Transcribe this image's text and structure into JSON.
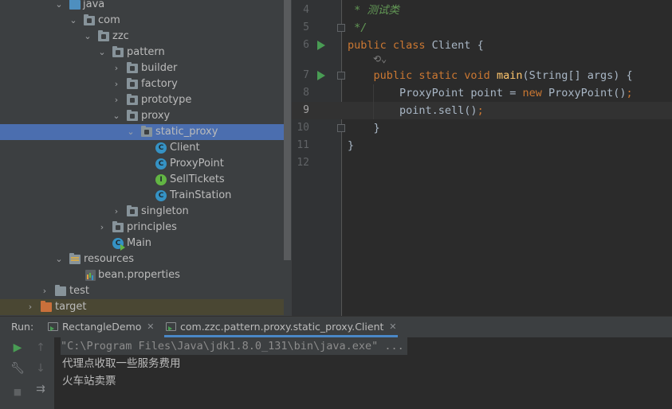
{
  "project_tree": {
    "items": [
      {
        "label": "java",
        "icon": "source-folder-icon",
        "expanded": true
      },
      {
        "label": "com",
        "icon": "package-icon",
        "expanded": true
      },
      {
        "label": "zzc",
        "icon": "package-icon",
        "expanded": true
      },
      {
        "label": "pattern",
        "icon": "package-icon",
        "expanded": true
      },
      {
        "label": "builder",
        "icon": "package-icon",
        "expanded": false
      },
      {
        "label": "factory",
        "icon": "package-icon",
        "expanded": false
      },
      {
        "label": "prototype",
        "icon": "package-icon",
        "expanded": false
      },
      {
        "label": "proxy",
        "icon": "package-icon",
        "expanded": true
      },
      {
        "label": "static_proxy",
        "icon": "package-icon",
        "expanded": true,
        "selected": true
      },
      {
        "label": "Client",
        "icon": "class-icon"
      },
      {
        "label": "ProxyPoint",
        "icon": "class-icon"
      },
      {
        "label": "SellTickets",
        "icon": "interface-icon"
      },
      {
        "label": "TrainStation",
        "icon": "class-icon"
      },
      {
        "label": "singleton",
        "icon": "package-icon",
        "expanded": false
      },
      {
        "label": "principles",
        "icon": "package-icon",
        "expanded": false
      },
      {
        "label": "Main",
        "icon": "main-class-icon"
      },
      {
        "label": "resources",
        "icon": "resources-folder-icon",
        "expanded": true
      },
      {
        "label": "bean.properties",
        "icon": "properties-file-icon"
      },
      {
        "label": "test",
        "icon": "folder-icon",
        "expanded": false
      },
      {
        "label": "target",
        "icon": "excluded-folder-icon",
        "expanded": false
      }
    ]
  },
  "editor": {
    "lines": [
      {
        "num": "4",
        "text": " * 测试类"
      },
      {
        "num": "5",
        "text": " */"
      },
      {
        "num": "6",
        "text": "public class Client {"
      },
      {
        "num": "7",
        "text": "    public static void main(String[] args) {"
      },
      {
        "num": "8",
        "text": "        ProxyPoint point = new ProxyPoint();"
      },
      {
        "num": "9",
        "text": "        point.sell();"
      },
      {
        "num": "10",
        "text": "    }"
      },
      {
        "num": "11",
        "text": "}"
      },
      {
        "num": "12",
        "text": ""
      }
    ],
    "current_line": "9",
    "hint_icon": "code-vision-icon"
  },
  "run_panel": {
    "label": "Run:",
    "tabs": [
      {
        "label": "RectangleDemo",
        "active": false
      },
      {
        "label": "com.zzc.pattern.proxy.static_proxy.Client",
        "active": true
      }
    ],
    "toolbar": [
      "run-icon",
      "up-arrow-icon",
      "wrench-icon",
      "down-arrow-icon",
      "stop-icon",
      "soft-wrap-icon"
    ],
    "console": [
      "\"C:\\Program Files\\Java\\jdk1.8.0_131\\bin\\java.exe\" ...",
      "代理点收取一些服务费用",
      "火车站卖票"
    ]
  },
  "colors": {
    "selection": "#4b6eaf",
    "keyword": "#cc7832",
    "function": "#ffc66d",
    "comment": "#629755",
    "run_green": "#499c54"
  }
}
